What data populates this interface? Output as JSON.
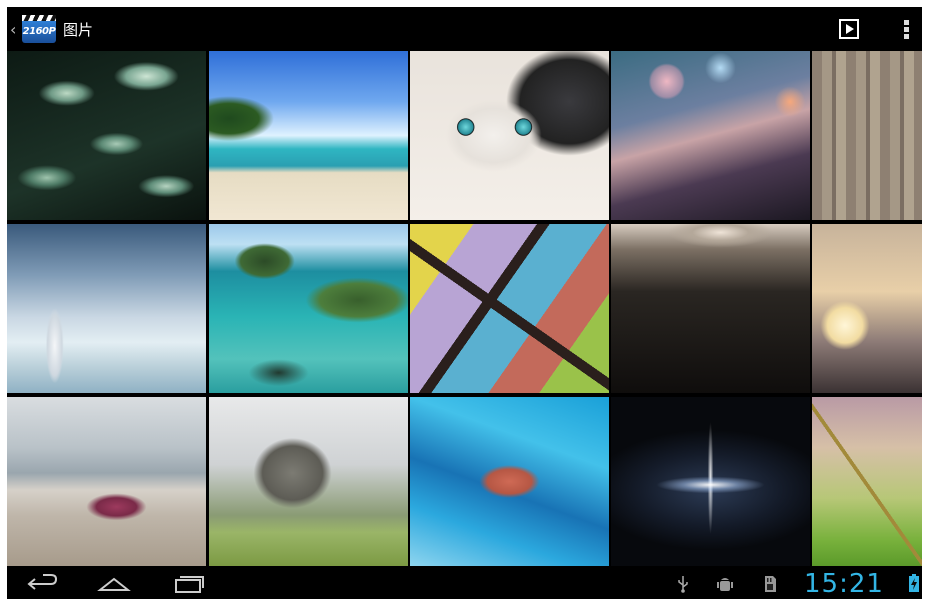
{
  "app": {
    "icon_text": "2160P",
    "title": "图片"
  },
  "action_bar": {
    "up_icon": "chevron-left-icon",
    "slideshow_icon": "play-slideshow-icon",
    "overflow_icon": "overflow-menu-icon"
  },
  "grid": {
    "columns": 5,
    "rows": 3,
    "tiles": [
      "leaves",
      "tropical-beach",
      "cat",
      "bokeh",
      "wood",
      "burj-al-arab",
      "island-lagoon",
      "stained-glass",
      "winding-road",
      "grass-sunset",
      "starfish",
      "elephant",
      "blue-rock",
      "space-light",
      "reed-field"
    ]
  },
  "nav_bar": {
    "back_icon": "back-icon",
    "home_icon": "home-icon",
    "recents_icon": "recents-icon"
  },
  "status_bar": {
    "usb_icon": "usb-icon",
    "debug_icon": "android-debug-icon",
    "sd_icon": "sd-card-icon",
    "time": "15:21",
    "battery_icon": "battery-charging-icon",
    "clock_color": "#33b5e5"
  }
}
